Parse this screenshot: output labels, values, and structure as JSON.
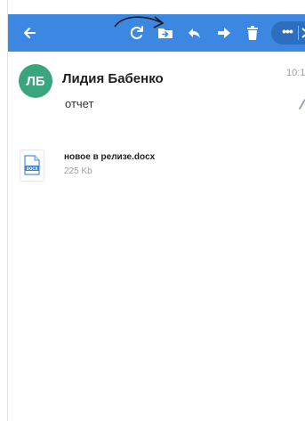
{
  "toolbar": {
    "background": "#3c87e2",
    "icons": {
      "back": "arrow-left-icon",
      "refresh": "refresh-icon",
      "move_to_folder": "folder-move-icon",
      "reply": "reply-icon",
      "forward": "forward-icon",
      "delete": "trash-icon",
      "more": "more-options-icon"
    },
    "more_label": "•••"
  },
  "message": {
    "avatar_initials": "ЛБ",
    "avatar_color": "#3aa67e",
    "sender_name": "Лидия Бабенко",
    "time": "10:1",
    "subject": "отчет"
  },
  "attachment": {
    "file_name": "новое в релизе.docx",
    "file_size": "225 Kb",
    "icon": "docx-file-icon"
  }
}
